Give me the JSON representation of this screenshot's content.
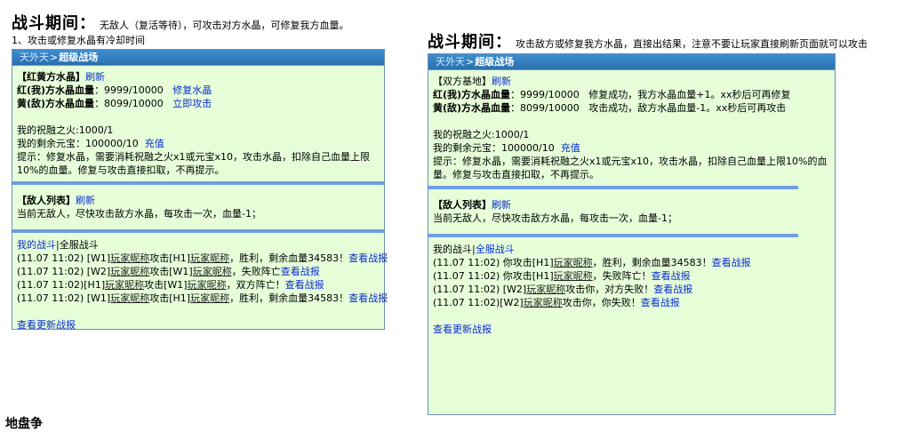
{
  "left": {
    "heading_big": "战斗期间：",
    "heading_small": "无敌人（复活等待），可攻击对方水晶，可修复我方血量。",
    "note": "1、攻击或修复水晶有冷却时间",
    "breadcrumb": {
      "home": "天外天",
      "sep": ">",
      "current": "超级战场"
    },
    "crystal": {
      "title": "【红黄方水晶】",
      "refresh": "刷新",
      "red_label": "红(我)方水晶血量",
      "red_value": "：9999/10000",
      "red_action": "修复水晶",
      "yellow_label": "黄(敌)方水晶血量",
      "yellow_value": "：8099/10000",
      "yellow_action": "立即攻击"
    },
    "blessing": "我的祝融之火:1000/1",
    "yuanbao_prefix": "我的剩余元宝：100000/10",
    "recharge": "充值",
    "hint": "提示：修复水晶，需要消耗祝融之火x1或元宝x10，攻击水晶，扣除自己血量上限10%的血量。修复与攻击直接扣取，不再提示。",
    "enemy": {
      "title": "【敌人列表】",
      "refresh": "刷新",
      "text": "当前无敌人，尽快攻击敌方水晶，每攻击一次，血量-1；"
    },
    "log_tabs": {
      "mine": "我的战斗",
      "sep": "|",
      "all": "全服战斗"
    },
    "log": [
      {
        "a": "(11.07 11:02) [W1]",
        "b": "玩家昵称",
        "c": "攻击[H1]",
        "d": "玩家昵称",
        "e": "，胜利，剩余血量34583！",
        "link": "查看战报"
      },
      {
        "a": "(11.07 11:02) [W2]",
        "b": "玩家昵称",
        "c": "攻击[W1]",
        "d": "玩家昵称",
        "e": "，失败阵亡",
        "link": "查看战报"
      },
      {
        "a": "(11.07 11:02)[H1]",
        "b": "玩家昵称",
        "c": "攻击[W1]",
        "d": "玩家昵称",
        "e": "，双方阵亡！",
        "link": "查看战报"
      },
      {
        "a": "(11.07 11:02) [W1]",
        "b": "玩家昵称",
        "c": "攻击[H1]",
        "d": "玩家昵称",
        "e": "，胜利，剩余血量34583！",
        "link": "查看战报"
      }
    ],
    "more": "查看更新战报"
  },
  "right": {
    "heading_big": "战斗期间：",
    "heading_small": "攻击敌方或修复我方水晶，直接出结果，注意不要让玩家直接刷新页面就可以攻击",
    "breadcrumb": {
      "home": "天外天",
      "sep": ">",
      "current": "超级战场"
    },
    "crystal": {
      "title": "【双方基地】",
      "refresh": "刷新",
      "red_label": "红(我)方水晶血量",
      "red_value": "：9999/10000",
      "red_msg": "修复成功，我方水晶血量+1。xx秒后可再修复",
      "yellow_label": "黄(敌)方水晶血量",
      "yellow_value": "：8099/10000",
      "yellow_msg": "攻击成功，敌方水晶血量-1。xx秒后可再攻击"
    },
    "blessing": "我的祝融之火:1000/1",
    "yuanbao_prefix": "我的剩余元宝：100000/10",
    "recharge": "充值",
    "hint": "提示：修复水晶，需要消耗祝融之火x1或元宝x10，攻击水晶，扣除自己血量上限10%的血量。修复与攻击直接扣取，不再提示。",
    "enemy": {
      "title": "【敌人列表】",
      "refresh": "刷新",
      "text": "当前无敌人，尽快攻击敌方水晶，每攻击一次，血量-1；"
    },
    "log_tabs": {
      "mine": "我的战斗",
      "sep": "|",
      "all": "全服战斗"
    },
    "log": [
      {
        "a": "(11.07 11:02)  你攻击[H1]",
        "b": "玩家昵称",
        "e": "，胜利，剩余血量34583！",
        "link": "查看战报"
      },
      {
        "a": "(11.07 11:02)  你攻击[H1]",
        "b": "玩家昵称",
        "e": "，失败阵亡！",
        "link": "查看战报"
      },
      {
        "a": "(11.07 11:02)  [W2]",
        "b": "玩家昵称",
        "e": "攻击你，对方失败！",
        "link": "查看战报"
      },
      {
        "a": "(11.07 11:02)[W2]",
        "b": "玩家昵称",
        "e": "攻击你，你失败！",
        "link": "查看战报"
      }
    ],
    "more": "查看更新战报"
  },
  "bottom_fragment": "地盘争"
}
